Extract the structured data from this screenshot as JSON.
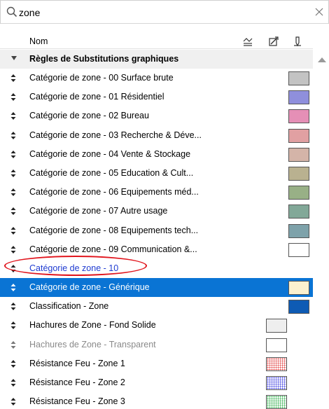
{
  "search": {
    "value": "zone",
    "placeholder": ""
  },
  "header": {
    "name_label": "Nom",
    "icons": [
      "surface-icon",
      "override-icon",
      "pen-icon"
    ]
  },
  "group": {
    "label": "Règles de Substitutions graphiques"
  },
  "rows": [
    {
      "label": "Catégorie de zone - 00 Surface brute",
      "swatch": "#c3c3c3",
      "state": "normal",
      "swatch_col": 2,
      "pattern": "none"
    },
    {
      "label": "Catégorie de zone - 01 Résidentiel",
      "swatch": "#8f8fdc",
      "state": "normal",
      "swatch_col": 2,
      "pattern": "none"
    },
    {
      "label": "Catégorie de zone - 02 Bureau",
      "swatch": "#e58fb6",
      "state": "normal",
      "swatch_col": 2,
      "pattern": "none"
    },
    {
      "label": "Catégorie de zone - 03 Recherche & Déve...",
      "swatch": "#e1a0a2",
      "state": "normal",
      "swatch_col": 2,
      "pattern": "none"
    },
    {
      "label": "Catégorie de zone - 04 Vente & Stockage",
      "swatch": "#d4b4a8",
      "state": "normal",
      "swatch_col": 2,
      "pattern": "none"
    },
    {
      "label": "Catégorie de zone - 05 Education & Cult...",
      "swatch": "#b9b190",
      "state": "normal",
      "swatch_col": 2,
      "pattern": "none"
    },
    {
      "label": "Catégorie de zone - 06 Equipements méd...",
      "swatch": "#98b086",
      "state": "normal",
      "swatch_col": 2,
      "pattern": "none"
    },
    {
      "label": "Catégorie de zone - 07 Autre usage",
      "swatch": "#82a898",
      "state": "normal",
      "swatch_col": 2,
      "pattern": "none"
    },
    {
      "label": "Catégorie de zone - 08 Equipements tech...",
      "swatch": "#7ea2aa",
      "state": "normal",
      "swatch_col": 2,
      "pattern": "none"
    },
    {
      "label": "Catégorie de zone - 09 Communication &...",
      "swatch": "#ffffff",
      "state": "normal",
      "swatch_col": 2,
      "pattern": "none"
    },
    {
      "label": "Catégorie de zone - 10",
      "swatch": "",
      "state": "highlight",
      "swatch_col": 0,
      "pattern": "none"
    },
    {
      "label": "Catégorie de zone - Générique",
      "swatch": "#fbf1cf",
      "state": "selected",
      "swatch_col": 2,
      "pattern": "none"
    },
    {
      "label": "Classification - Zone",
      "swatch": "#0e5bb4",
      "state": "normal",
      "swatch_col": 2,
      "pattern": "none"
    },
    {
      "label": "Hachures de Zone - Fond Solide",
      "swatch": "#eeeeee",
      "state": "normal",
      "swatch_col": 1,
      "pattern": "none"
    },
    {
      "label": "Hachures de Zone - Transparent",
      "swatch": "#ffffff",
      "state": "disabled",
      "swatch_col": 1,
      "pattern": "none"
    },
    {
      "label": "Résistance Feu - Zone 1",
      "swatch": "#e23f3f",
      "state": "normal",
      "swatch_col": 1,
      "pattern": "dots"
    },
    {
      "label": "Résistance Feu - Zone 2",
      "swatch": "#3f3fe2",
      "state": "normal",
      "swatch_col": 1,
      "pattern": "dots"
    },
    {
      "label": "Résistance Feu - Zone 3",
      "swatch": "#2fae4a",
      "state": "normal",
      "swatch_col": 1,
      "pattern": "dots"
    }
  ],
  "colors": {
    "selection": "#0a74d4",
    "highlight_text": "#1f3bd1",
    "annotation_oval": "#e1141c"
  }
}
